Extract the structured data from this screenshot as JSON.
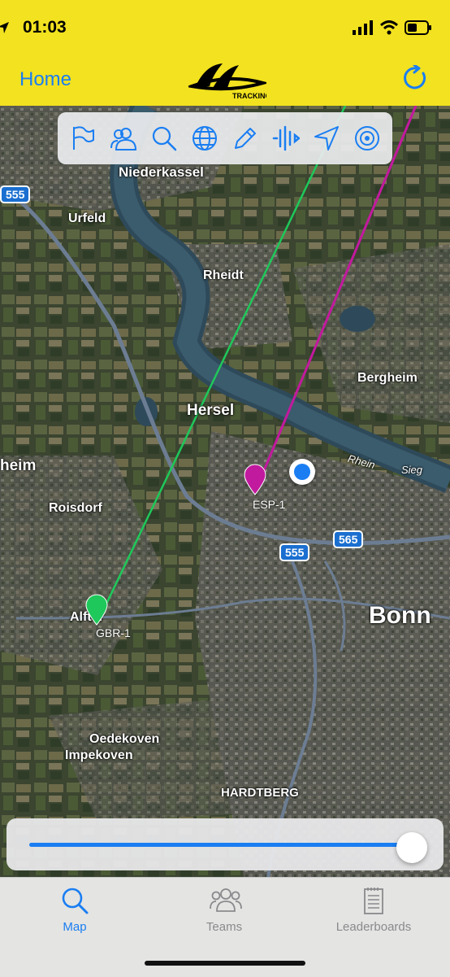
{
  "status_bar": {
    "time": "01:03"
  },
  "header": {
    "back_label": "Home",
    "logo_text": "TRACKING"
  },
  "toolbar": {
    "icons": [
      "flag-icon",
      "teams-icon",
      "search-icon",
      "globe-icon",
      "pencil-icon",
      "waveform-icon",
      "location-arrow-icon",
      "target-icon"
    ]
  },
  "map": {
    "places": {
      "niederkassel": "Niederkassel",
      "urfeld": "Urfeld",
      "rheidt": "Rheidt",
      "bergheim": "Bergheim",
      "hersel": "Hersel",
      "heim": "heim",
      "roisdorf": "Roisdorf",
      "bonn": "Bonn",
      "alfter": "Alfter",
      "oedekoven": "Oedekoven",
      "impekoven": "Impekoven",
      "hardtberg": "HARDTBERG",
      "rhein": "Rhein",
      "sieg": "Sieg"
    },
    "road_shields": {
      "a": "555",
      "b": "555",
      "c": "565"
    },
    "markers": [
      {
        "label": "ESP-1",
        "color": "#c21a9e"
      },
      {
        "label": "GBR-1",
        "color": "#1fc85a"
      }
    ],
    "user_location_color": "#1a7ef2"
  },
  "slider": {
    "value": 1.0
  },
  "tabbar": {
    "tabs": [
      {
        "label": "Map",
        "active": true
      },
      {
        "label": "Teams",
        "active": false
      },
      {
        "label": "Leaderboards",
        "active": false
      }
    ],
    "active_color": "#1a7ef2",
    "inactive_color": "#8a8a8e"
  }
}
